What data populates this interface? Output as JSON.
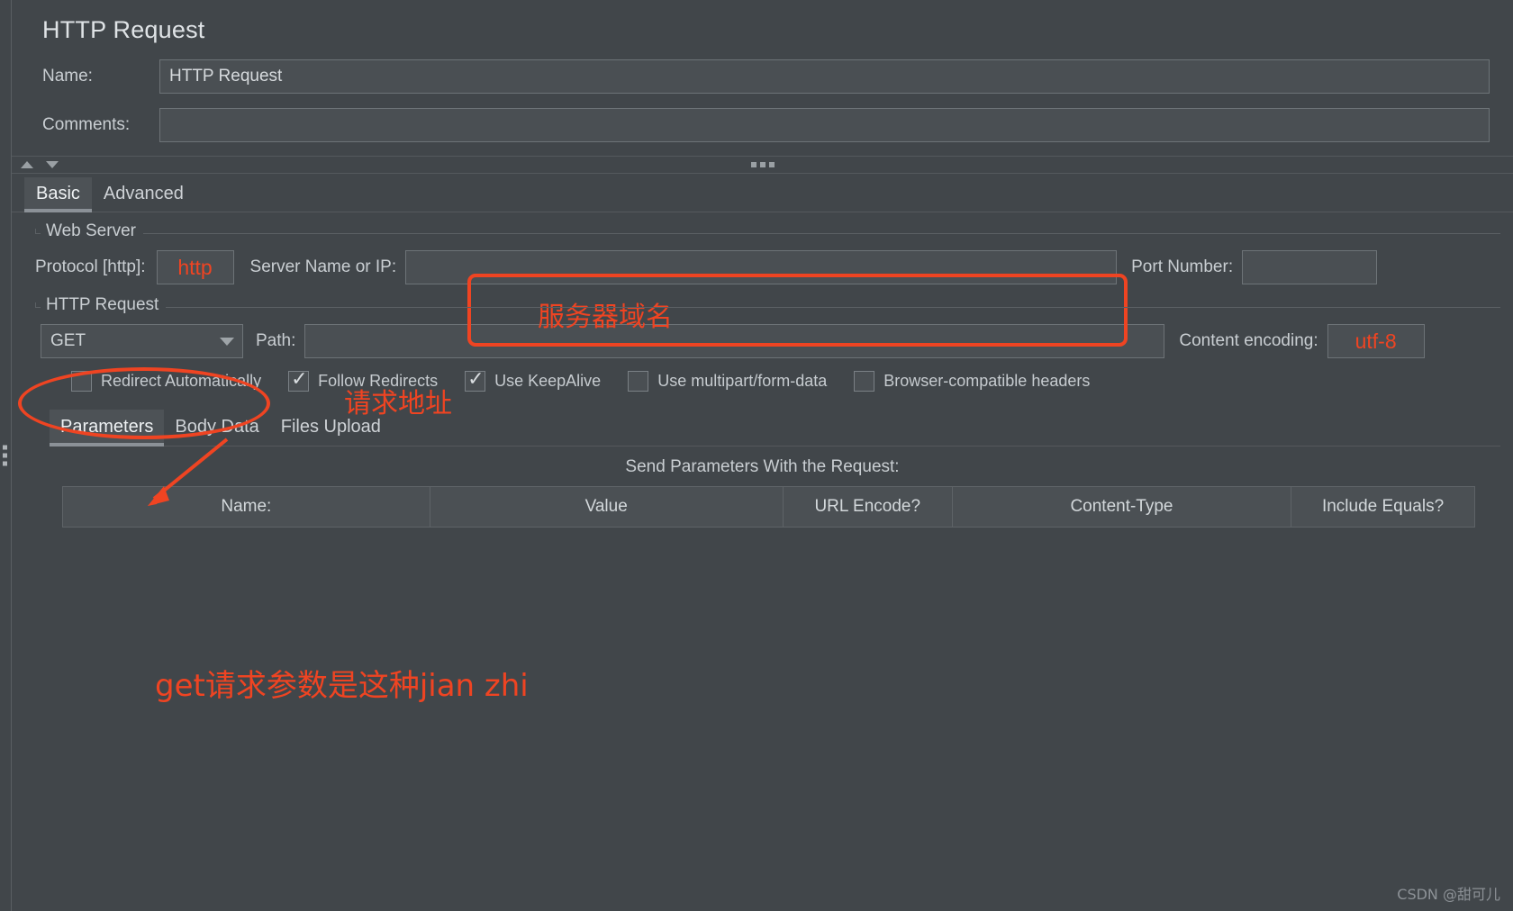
{
  "window": {
    "title": "HTTP Request"
  },
  "form": {
    "name_label": "Name:",
    "name_value": "HTTP Request",
    "comments_label": "Comments:",
    "comments_value": ""
  },
  "main_tabs": [
    {
      "label": "Basic",
      "active": true
    },
    {
      "label": "Advanced",
      "active": false
    }
  ],
  "web_server": {
    "legend": "Web Server",
    "protocol_label": "Protocol [http]:",
    "protocol_value": "http",
    "server_label": "Server Name or IP:",
    "server_value": "",
    "port_label": "Port Number:",
    "port_value": ""
  },
  "http_request": {
    "legend": "HTTP Request",
    "method_value": "GET",
    "path_label": "Path:",
    "path_value": "",
    "encoding_label": "Content encoding:",
    "encoding_value": "utf-8"
  },
  "checkboxes": [
    {
      "label": "Redirect Automatically",
      "checked": false
    },
    {
      "label": "Follow Redirects",
      "checked": true
    },
    {
      "label": "Use KeepAlive",
      "checked": true
    },
    {
      "label": "Use multipart/form-data",
      "checked": false
    },
    {
      "label": "Browser-compatible headers",
      "checked": false
    }
  ],
  "inner_tabs": [
    {
      "label": "Parameters",
      "active": true
    },
    {
      "label": "Body Data",
      "active": false
    },
    {
      "label": "Files Upload",
      "active": false
    }
  ],
  "parameters": {
    "caption": "Send Parameters With the Request:",
    "columns": [
      "Name:",
      "Value",
      "URL Encode?",
      "Content-Type",
      "Include Equals?"
    ],
    "rows": []
  },
  "annotations": {
    "color": "#ef4422",
    "server_domain_note": "服务器域名",
    "request_path_note": "请求地址",
    "get_params_note": "get请求参数是这种jian zhi"
  },
  "watermark": "CSDN @甜可儿"
}
